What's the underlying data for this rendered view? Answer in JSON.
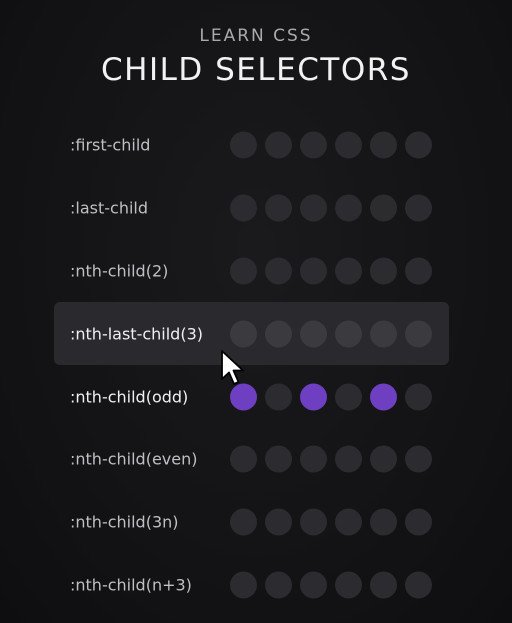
{
  "header": {
    "eyebrow": "LEARN CSS",
    "title": "CHILD SELECTORS"
  },
  "colors": {
    "background": "#141416",
    "dot_inactive": "#2c2c30",
    "dot_active": "#6e3fc0",
    "highlight_row": "#2a2a2e"
  },
  "selectors": [
    {
      "label": ":first-child",
      "active": [
        false,
        false,
        false,
        false,
        false,
        false
      ]
    },
    {
      "label": ":last-child",
      "active": [
        false,
        false,
        false,
        false,
        false,
        false
      ]
    },
    {
      "label": ":nth-child(2)",
      "active": [
        false,
        false,
        false,
        false,
        false,
        false
      ]
    },
    {
      "label": ":nth-last-child(3)",
      "active": [
        false,
        false,
        false,
        true,
        false,
        false
      ],
      "highlighted": true
    },
    {
      "label": ":nth-child(odd)",
      "active": [
        true,
        false,
        true,
        false,
        true,
        false
      ]
    },
    {
      "label": ":nth-child(even)",
      "active": [
        false,
        false,
        false,
        false,
        false,
        false
      ]
    },
    {
      "label": ":nth-child(3n)",
      "active": [
        false,
        false,
        false,
        false,
        false,
        false
      ]
    },
    {
      "label": ":nth-child(n+3)",
      "active": [
        false,
        false,
        false,
        false,
        false,
        false
      ]
    }
  ],
  "cursor": {
    "icon": "mouse-pointer-icon"
  }
}
